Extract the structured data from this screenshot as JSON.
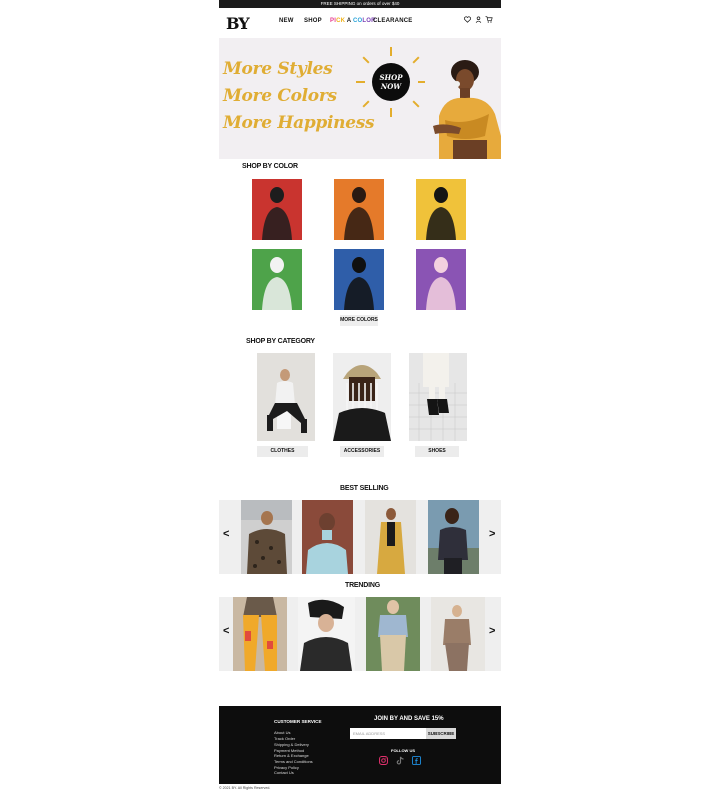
{
  "promo": "FREE SHIPPING on orders of over $40",
  "nav": {
    "logo": "BY",
    "links": [
      "NEW",
      "SHOP",
      "PICK A COLOR",
      "CLEARANCE"
    ],
    "icons": [
      "heart-icon",
      "user-icon",
      "cart-icon"
    ]
  },
  "hero": {
    "lines": [
      "More Styles",
      "More Colors",
      "More Happiness"
    ],
    "cta": "SHOP NOW"
  },
  "shop_by_color": {
    "title": "SHOP BY COLOR",
    "colors": [
      "#c9342f",
      "#e57a2a",
      "#f0c23a",
      "#4ea34a",
      "#2f5ea9",
      "#8a54b4"
    ],
    "more_button": "MORE COLORS"
  },
  "shop_by_category": {
    "title": "SHOP BY CATEGORY",
    "categories": [
      "CLOTHES",
      "ACCESSORIES",
      "SHOES"
    ]
  },
  "best_selling": {
    "title": "BEST SELLING"
  },
  "trending": {
    "title": "TRENDING"
  },
  "carousel": {
    "prev": "<",
    "next": ">"
  },
  "footer": {
    "customer_service_title": "CUSTOMER SERVICE",
    "links": [
      "About Us",
      "Track Order",
      "Shipping & Delivery",
      "Payment Method",
      "Return & Exchange",
      "Terms and Conditions",
      "Privacy Policy",
      "Contact Us"
    ],
    "join_title": "JOIN BY AND SAVE 15%",
    "email_placeholder": "EMAIL ADDRESS",
    "subscribe": "SUBSCRIBE",
    "follow_title": "FOLLOW US",
    "social": [
      "instagram-icon",
      "tiktok-icon",
      "facebook-icon"
    ]
  },
  "copyright": "© 2021 BY. All Rights Reserved."
}
